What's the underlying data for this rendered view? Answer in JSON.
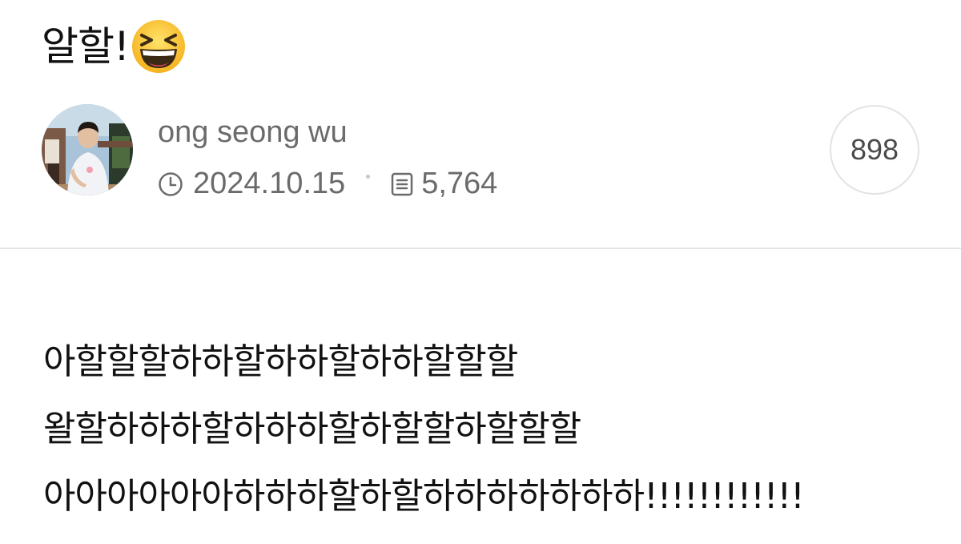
{
  "post": {
    "title": "알할!",
    "title_emoji": "grinning-squinting-face-emoji"
  },
  "author": {
    "name": "ong seong wu",
    "avatar": "profile-photo-avatar"
  },
  "meta": {
    "date": "2024.10.15",
    "views": "5,764",
    "date_icon": "clock-icon",
    "views_icon": "document-icon"
  },
  "likes": {
    "count": "898"
  },
  "content": {
    "lines": [
      "아할할할하하할하하할하하할할할",
      "왈할하하하할하하하할하할할하할할할",
      "아아아아아아하하하할하할하하하하하하하!!!!!!!!!!!!"
    ]
  },
  "colors": {
    "meta_text": "#6b6b6b",
    "divider": "#e4e4e4",
    "body_text": "#111111"
  }
}
